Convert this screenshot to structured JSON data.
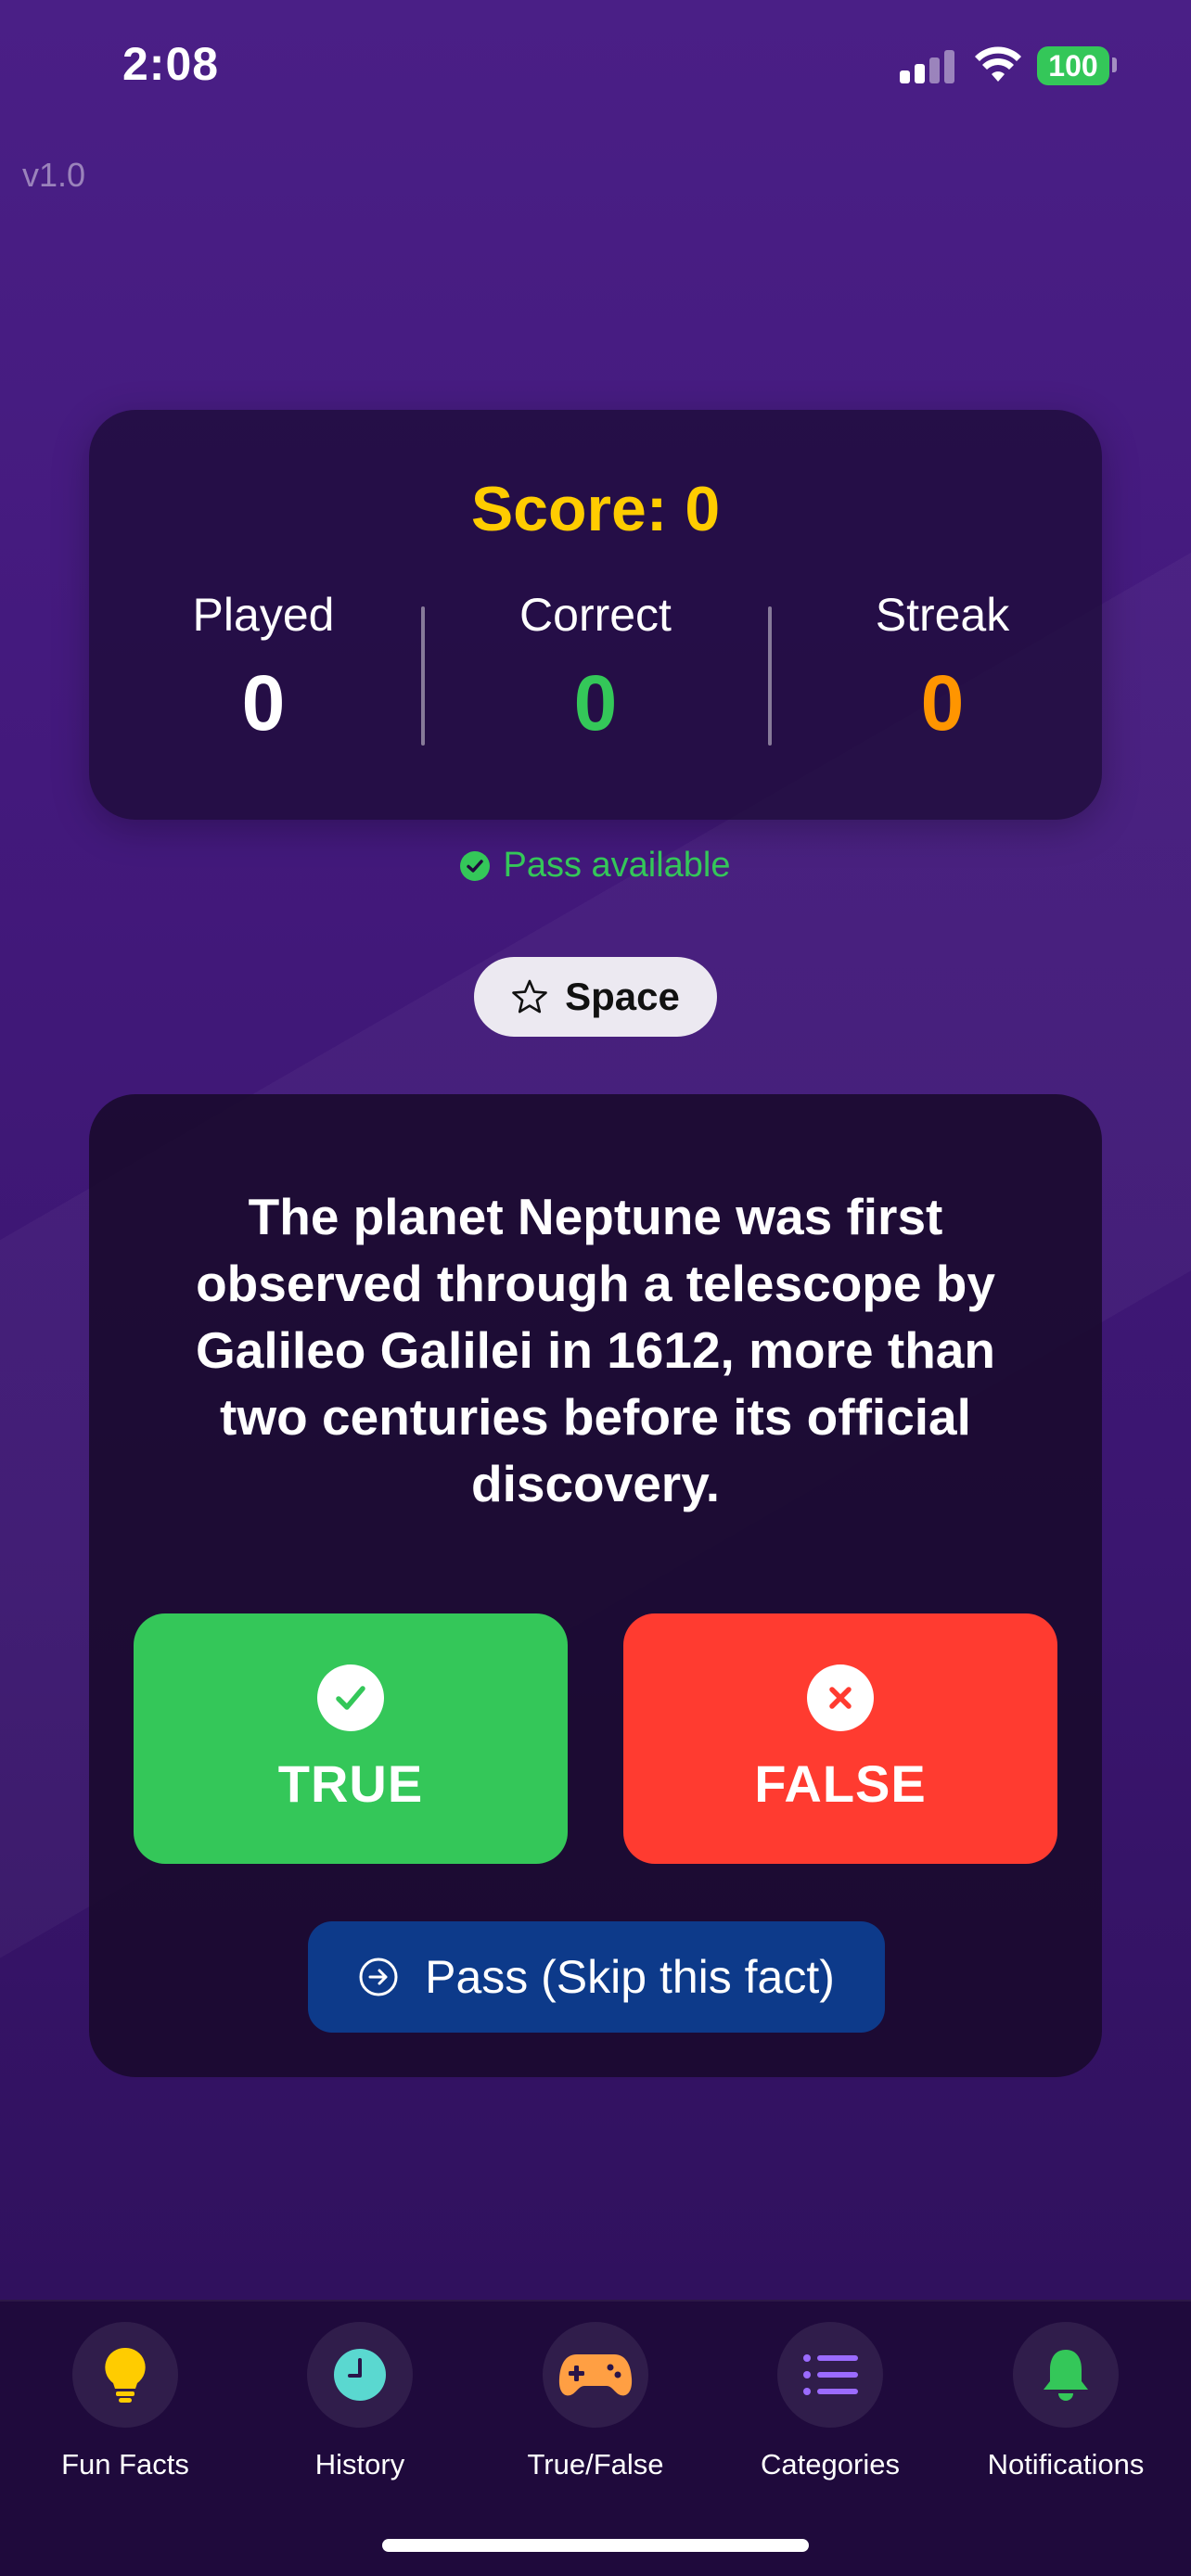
{
  "status_bar": {
    "time": "2:08",
    "battery": "100"
  },
  "version": "v1.0",
  "score": {
    "title": "Score: 0",
    "stats": [
      {
        "label": "Played",
        "value": "0",
        "color": "#ffffff"
      },
      {
        "label": "Correct",
        "value": "0",
        "color": "#34c759"
      },
      {
        "label": "Streak",
        "value": "0",
        "color": "#ff9500"
      }
    ]
  },
  "pass_status": "Pass available",
  "category": {
    "label": "Space",
    "icon": "star-icon"
  },
  "question": {
    "text": "The planet Neptune was first observed through a telescope by Galileo Galilei in 1612, more than two centuries before its official discovery."
  },
  "answers": {
    "true_label": "TRUE",
    "false_label": "FALSE"
  },
  "pass_button": {
    "label": "Pass (Skip this fact)"
  },
  "tabs": [
    {
      "label": "Fun Facts",
      "icon": "lightbulb-icon",
      "color": "#ffcc00"
    },
    {
      "label": "History",
      "icon": "clock-icon",
      "color": "#5ad8d0"
    },
    {
      "label": "True/False",
      "icon": "gamecontroller-icon",
      "color": "#ff9f43"
    },
    {
      "label": "Categories",
      "icon": "list-icon",
      "color": "#9b6bff"
    },
    {
      "label": "Notifications",
      "icon": "bell-icon",
      "color": "#34c759"
    }
  ],
  "colors": {
    "accent_yellow": "#ffcc00",
    "true_green": "#34c759",
    "false_red": "#ff3b30",
    "pass_blue": "#0d3a8a"
  }
}
